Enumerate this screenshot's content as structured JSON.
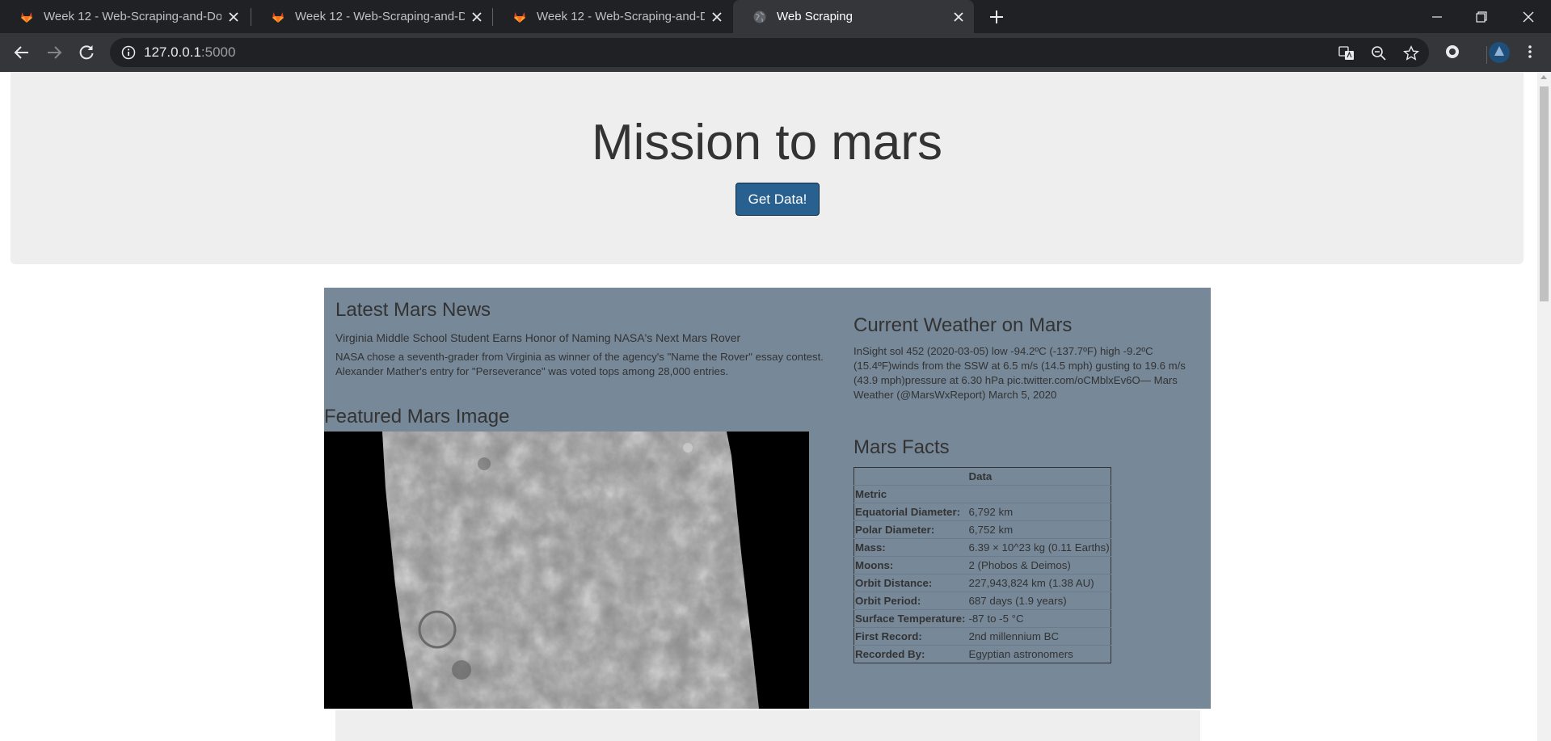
{
  "browser": {
    "tabs": [
      {
        "title": "Week 12 - Web-Scraping-and-Do",
        "icon": "gitlab-icon",
        "active": false
      },
      {
        "title": "Week 12 - Web-Scraping-and-Do",
        "icon": "gitlab-icon",
        "active": false
      },
      {
        "title": "Week 12 - Web-Scraping-and-Do",
        "icon": "gitlab-icon",
        "active": false
      },
      {
        "title": "Web Scraping",
        "icon": "globe-icon",
        "active": true
      }
    ],
    "url_host": "127.0.0.1",
    "url_port": ":5000"
  },
  "page": {
    "title": "Mission to mars",
    "get_data_label": "Get Data!",
    "news": {
      "heading": "Latest Mars News",
      "title": "Virginia Middle School Student Earns Honor of Naming NASA's Next Mars Rover",
      "paragraph": "NASA chose a seventh-grader from Virginia as winner of the agency's \"Name the Rover\" essay contest. Alexander Mather's entry for \"Perseverance\" was voted tops among 28,000 entries."
    },
    "featured": {
      "heading": "Featured Mars Image"
    },
    "weather": {
      "heading": "Current Weather on Mars",
      "text": "InSight sol 452 (2020-03-05) low -94.2ºC (-137.7ºF) high -9.2ºC (15.4ºF)winds from the SSW at 6.5 m/s (14.5 mph) gusting to 19.6 m/s (43.9 mph)pressure at 6.30 hPa pic.twitter.com/oCMblxEv6O— Mars Weather (@MarsWxReport) March 5, 2020"
    },
    "facts": {
      "heading": "Mars Facts",
      "column_header": "Data",
      "index_header": "Metric",
      "rows": [
        {
          "metric": "Equatorial Diameter:",
          "value": "6,792 km"
        },
        {
          "metric": "Polar Diameter:",
          "value": "6,752 km"
        },
        {
          "metric": "Mass:",
          "value": "6.39 × 10^23 kg (0.11 Earths)"
        },
        {
          "metric": "Moons:",
          "value": "2 (Phobos & Deimos)"
        },
        {
          "metric": "Orbit Distance:",
          "value": "227,943,824 km (1.38 AU)"
        },
        {
          "metric": "Orbit Period:",
          "value": "687 days (1.9 years)"
        },
        {
          "metric": "Surface Temperature:",
          "value": "-87 to -5 °C"
        },
        {
          "metric": "First Record:",
          "value": "2nd millennium BC"
        },
        {
          "metric": "Recorded By:",
          "value": "Egyptian astronomers"
        }
      ]
    },
    "colors": {
      "panel_background": "#778899",
      "jumbotron_background": "#eeeeee",
      "button_primary": "#286090"
    }
  }
}
